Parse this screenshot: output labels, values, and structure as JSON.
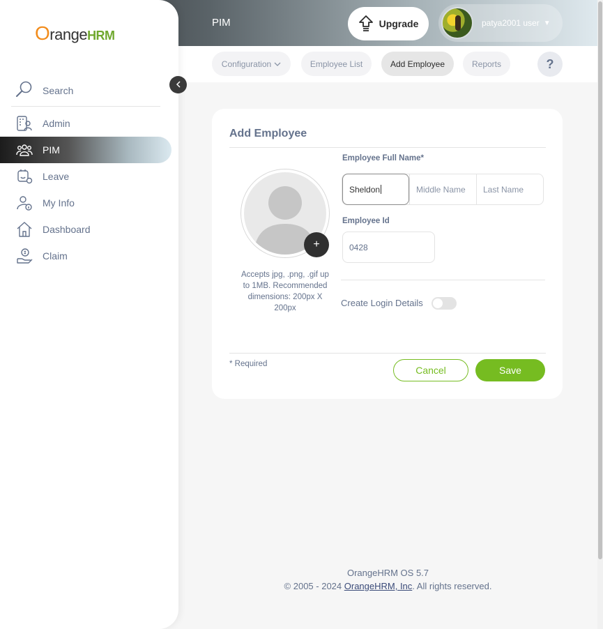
{
  "header": {
    "module_title": "PIM",
    "upgrade_label": "Upgrade",
    "user_name": "patya2001 user"
  },
  "subnav": {
    "items": [
      {
        "label": "Configuration"
      },
      {
        "label": "Employee List"
      },
      {
        "label": "Add Employee",
        "active": true
      },
      {
        "label": "Reports"
      }
    ],
    "help_label": "?"
  },
  "sidebar": {
    "brand": {
      "o": "O",
      "range": "range",
      "hrm": "HRM"
    },
    "search_label": "Search",
    "items": [
      {
        "label": "Admin",
        "icon": "admin-icon"
      },
      {
        "label": "PIM",
        "icon": "pim-icon",
        "active": true
      },
      {
        "label": "Leave",
        "icon": "leave-icon"
      },
      {
        "label": "My Info",
        "icon": "my-info-icon"
      },
      {
        "label": "Dashboard",
        "icon": "dashboard-icon"
      },
      {
        "label": "Claim",
        "icon": "claim-icon"
      }
    ]
  },
  "form": {
    "title": "Add Employee",
    "photo_hint": "Accepts jpg, .png, .gif up to 1MB. Recommended dimensions: 200px X 200px",
    "add_photo_label": "+",
    "full_name_label": "Employee Full Name*",
    "first_name_value": "Sheldon",
    "middle_name_placeholder": "Middle Name",
    "last_name_placeholder": "Last Name",
    "employee_id_label": "Employee Id",
    "employee_id_value": "0428",
    "create_login_label": "Create Login Details",
    "create_login_enabled": false,
    "required_note": "* Required",
    "cancel_label": "Cancel",
    "save_label": "Save"
  },
  "footer": {
    "version": "OrangeHRM OS 5.7",
    "copyright_prefix": "© 2005 - 2024 ",
    "company_link": "OrangeHRM, Inc",
    "copyright_suffix": ". All rights reserved."
  },
  "colors": {
    "accent": "#76bc21",
    "text": "#64728c",
    "brand_orange": "#f28c1c"
  }
}
